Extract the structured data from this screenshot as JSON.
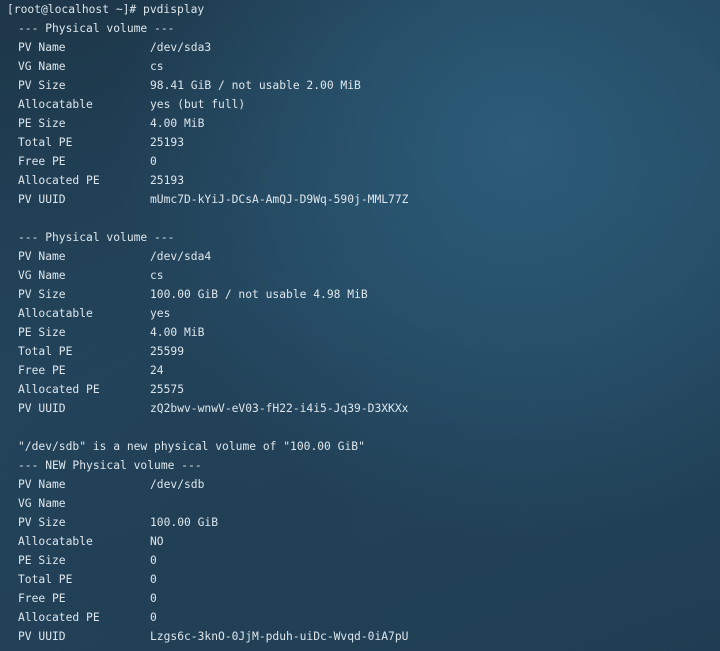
{
  "terminal": {
    "prompt": "[root@localhost ~]# pvdisplay",
    "volumes": [
      {
        "header": "--- Physical volume ---",
        "fields": [
          {
            "k": "PV Name",
            "v": "/dev/sda3"
          },
          {
            "k": "VG Name",
            "v": "cs"
          },
          {
            "k": "PV Size",
            "v": "98.41 GiB / not usable 2.00 MiB"
          },
          {
            "k": "Allocatable",
            "v": "yes (but full)"
          },
          {
            "k": "PE Size",
            "v": "4.00 MiB"
          },
          {
            "k": "Total PE",
            "v": "25193"
          },
          {
            "k": "Free PE",
            "v": "0"
          },
          {
            "k": "Allocated PE",
            "v": "25193"
          },
          {
            "k": "PV UUID",
            "v": "mUmc7D-kYiJ-DCsA-AmQJ-D9Wq-590j-MML77Z"
          }
        ]
      },
      {
        "header": "--- Physical volume ---",
        "fields": [
          {
            "k": "PV Name",
            "v": "/dev/sda4"
          },
          {
            "k": "VG Name",
            "v": "cs"
          },
          {
            "k": "PV Size",
            "v": "100.00 GiB / not usable 4.98 MiB"
          },
          {
            "k": "Allocatable",
            "v": "yes"
          },
          {
            "k": "PE Size",
            "v": "4.00 MiB"
          },
          {
            "k": "Total PE",
            "v": "25599"
          },
          {
            "k": "Free PE",
            "v": "24"
          },
          {
            "k": "Allocated PE",
            "v": "25575"
          },
          {
            "k": "PV UUID",
            "v": "zQ2bwv-wnwV-eV03-fH22-i4i5-Jq39-D3XKXx"
          }
        ]
      },
      {
        "notice": "\"/dev/sdb\" is a new physical volume of \"100.00 GiB\"",
        "header": "--- NEW Physical volume ---",
        "fields": [
          {
            "k": "PV Name",
            "v": "/dev/sdb"
          },
          {
            "k": "VG Name",
            "v": ""
          },
          {
            "k": "PV Size",
            "v": "100.00 GiB"
          },
          {
            "k": "Allocatable",
            "v": "NO"
          },
          {
            "k": "PE Size",
            "v": "0"
          },
          {
            "k": "Total PE",
            "v": "0"
          },
          {
            "k": "Free PE",
            "v": "0"
          },
          {
            "k": "Allocated PE",
            "v": "0"
          },
          {
            "k": "PV UUID",
            "v": "Lzgs6c-3knO-0JjM-pduh-uiDc-Wvqd-0iA7pU"
          }
        ]
      }
    ]
  },
  "colors": {
    "text": "#dde6ec",
    "background": "#24475f"
  }
}
